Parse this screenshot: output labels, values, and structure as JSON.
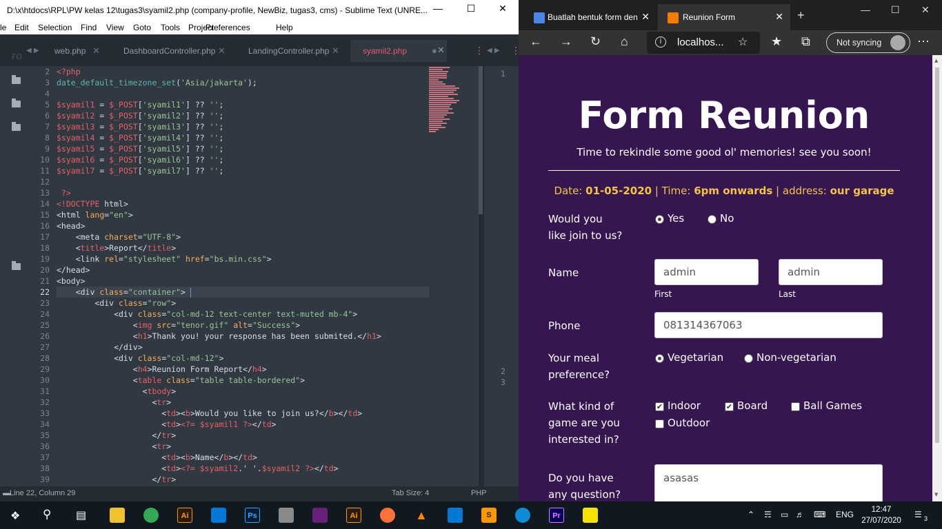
{
  "sublime": {
    "title": "D:\\x\\htdocs\\RPL\\PW kelas 12\\tugas3\\syamil2.php (company-profile, NewBiz, tugas3, cms) - Sublime Text (UNRE...",
    "menu": [
      "le",
      "Edit",
      "Selection",
      "Find",
      "View",
      "Goto",
      "Tools",
      "Project",
      "Preferences",
      "Help"
    ],
    "tabs": [
      "web.php",
      "DashboardController.php",
      "LandingController.php",
      "syamil2.php"
    ],
    "active_tab": "syamil2.php",
    "gutter": [
      "2",
      "3",
      "4",
      "5",
      "6",
      "7",
      "8",
      "9",
      "10",
      "11",
      "12",
      "13",
      "14",
      "15",
      "16",
      "17",
      "18",
      "19",
      "20",
      "21",
      "22",
      "23",
      "24",
      "25",
      "26",
      "27",
      "28",
      "29",
      "30",
      "31",
      "32",
      "33",
      "34",
      "35",
      "36",
      "37",
      "38",
      "39"
    ],
    "second_pane_lines": [
      "1",
      "2",
      "3"
    ],
    "status_position": "Line 22, Column 29",
    "status_tab": "Tab Size: 4",
    "status_syntax": "PHP",
    "sidebar_label": "FO"
  },
  "code_lines": [
    [
      [
        "<?php",
        "t-tag"
      ]
    ],
    [
      [
        "date_default_timezone_set",
        "t-fn"
      ],
      [
        "(",
        ""
      ],
      [
        "'Asia/jakarta'",
        "t-str"
      ],
      [
        ");",
        ""
      ]
    ],
    [
      [
        "",
        ""
      ]
    ],
    [
      [
        "$syamil1",
        "t-var"
      ],
      [
        " = ",
        ""
      ],
      [
        "$_POST",
        "t-var"
      ],
      [
        "[",
        ""
      ],
      [
        "'syamil1'",
        "t-str"
      ],
      [
        "] ?? ",
        ""
      ],
      [
        "''",
        "t-str"
      ],
      [
        ";",
        ""
      ]
    ],
    [
      [
        "$syamil2",
        "t-var"
      ],
      [
        " = ",
        ""
      ],
      [
        "$_POST",
        "t-var"
      ],
      [
        "[",
        ""
      ],
      [
        "'syamil2'",
        "t-str"
      ],
      [
        "] ?? ",
        ""
      ],
      [
        "''",
        "t-str"
      ],
      [
        ";",
        ""
      ]
    ],
    [
      [
        "$syamil3",
        "t-var"
      ],
      [
        " = ",
        ""
      ],
      [
        "$_POST",
        "t-var"
      ],
      [
        "[",
        ""
      ],
      [
        "'syamil3'",
        "t-str"
      ],
      [
        "] ?? ",
        ""
      ],
      [
        "''",
        "t-str"
      ],
      [
        ";",
        ""
      ]
    ],
    [
      [
        "$syamil4",
        "t-var"
      ],
      [
        " = ",
        ""
      ],
      [
        "$_POST",
        "t-var"
      ],
      [
        "[",
        ""
      ],
      [
        "'syamil4'",
        "t-str"
      ],
      [
        "] ?? ",
        ""
      ],
      [
        "''",
        "t-str"
      ],
      [
        ";",
        ""
      ]
    ],
    [
      [
        "$syamil5",
        "t-var"
      ],
      [
        " = ",
        ""
      ],
      [
        "$_POST",
        "t-var"
      ],
      [
        "[",
        ""
      ],
      [
        "'syamil5'",
        "t-str"
      ],
      [
        "] ?? ",
        ""
      ],
      [
        "''",
        "t-str"
      ],
      [
        ";",
        ""
      ]
    ],
    [
      [
        "$syamil6",
        "t-var"
      ],
      [
        " = ",
        ""
      ],
      [
        "$_POST",
        "t-var"
      ],
      [
        "[",
        ""
      ],
      [
        "'syamil6'",
        "t-str"
      ],
      [
        "] ?? ",
        ""
      ],
      [
        "''",
        "t-str"
      ],
      [
        ";",
        ""
      ]
    ],
    [
      [
        "$syamil7",
        "t-var"
      ],
      [
        " = ",
        ""
      ],
      [
        "$_POST",
        "t-var"
      ],
      [
        "[",
        ""
      ],
      [
        "'syamil7'",
        "t-str"
      ],
      [
        "] ?? ",
        ""
      ],
      [
        "''",
        "t-str"
      ],
      [
        ";",
        ""
      ]
    ],
    [
      [
        "",
        ""
      ]
    ],
    [
      [
        " ?>",
        "t-tag"
      ]
    ],
    [
      [
        "<!DOCTYPE ",
        "t-tag"
      ],
      [
        "html>",
        ""
      ]
    ],
    [
      [
        "<html ",
        ""
      ],
      [
        "lang",
        "t-at"
      ],
      [
        "=",
        ""
      ],
      [
        "\"en\"",
        "t-str"
      ],
      [
        ">",
        ""
      ]
    ],
    [
      [
        "<head>",
        ""
      ]
    ],
    [
      [
        "    <meta ",
        ""
      ],
      [
        "charset",
        "t-at"
      ],
      [
        "=",
        ""
      ],
      [
        "\"UTF-8\"",
        "t-str"
      ],
      [
        ">",
        ""
      ]
    ],
    [
      [
        "    <",
        ""
      ],
      [
        "title",
        "t-tag"
      ],
      [
        ">Report</",
        ""
      ],
      [
        "title",
        "t-tag"
      ],
      [
        ">",
        ""
      ]
    ],
    [
      [
        "    <link ",
        ""
      ],
      [
        "rel",
        "t-at"
      ],
      [
        "=",
        ""
      ],
      [
        "\"stylesheet\"",
        "t-str"
      ],
      [
        " ",
        ""
      ],
      [
        "href",
        "t-at"
      ],
      [
        "=",
        ""
      ],
      [
        "\"bs.min.css\"",
        "t-str"
      ],
      [
        ">",
        ""
      ]
    ],
    [
      [
        "</head>",
        ""
      ]
    ],
    [
      [
        "<body>",
        ""
      ]
    ],
    [
      [
        "    <div ",
        ""
      ],
      [
        "class",
        "t-at"
      ],
      [
        "=",
        ""
      ],
      [
        "\"container\"",
        "t-str"
      ],
      [
        "> ",
        ""
      ]
    ],
    [
      [
        "        <div ",
        ""
      ],
      [
        "class",
        "t-at"
      ],
      [
        "=",
        ""
      ],
      [
        "\"row\"",
        "t-str"
      ],
      [
        ">",
        ""
      ]
    ],
    [
      [
        "            <div ",
        ""
      ],
      [
        "class",
        "t-at"
      ],
      [
        "=",
        ""
      ],
      [
        "\"col-md-12 text-center text-muted mb-4\"",
        "t-str"
      ],
      [
        ">",
        ""
      ]
    ],
    [
      [
        "                <",
        ""
      ],
      [
        "img",
        "t-tag"
      ],
      [
        " ",
        ""
      ],
      [
        "src",
        "t-at"
      ],
      [
        "=",
        ""
      ],
      [
        "\"tenor.gif\"",
        "t-str"
      ],
      [
        " ",
        ""
      ],
      [
        "alt",
        "t-at"
      ],
      [
        "=",
        ""
      ],
      [
        "\"Success\"",
        "t-str"
      ],
      [
        ">",
        ""
      ]
    ],
    [
      [
        "                <",
        ""
      ],
      [
        "h1",
        "t-tag"
      ],
      [
        ">Thank you! your response has been submited.</",
        ""
      ],
      [
        "h1",
        "t-tag"
      ],
      [
        ">",
        ""
      ]
    ],
    [
      [
        "            </div>",
        ""
      ]
    ],
    [
      [
        "            <div ",
        ""
      ],
      [
        "class",
        "t-at"
      ],
      [
        "=",
        ""
      ],
      [
        "\"col-md-12\"",
        "t-str"
      ],
      [
        ">",
        ""
      ]
    ],
    [
      [
        "                <",
        ""
      ],
      [
        "h4",
        "t-tag"
      ],
      [
        ">Reunion Form Report</",
        ""
      ],
      [
        "h4",
        "t-tag"
      ],
      [
        ">",
        ""
      ]
    ],
    [
      [
        "                <",
        ""
      ],
      [
        "table",
        "t-tag"
      ],
      [
        " ",
        ""
      ],
      [
        "class",
        "t-at"
      ],
      [
        "=",
        ""
      ],
      [
        "\"table table-bordered\"",
        "t-str"
      ],
      [
        ">",
        ""
      ]
    ],
    [
      [
        "                  <",
        ""
      ],
      [
        "tbody",
        "t-tag"
      ],
      [
        ">",
        ""
      ]
    ],
    [
      [
        "                    <",
        ""
      ],
      [
        "tr",
        "t-tag"
      ],
      [
        ">",
        ""
      ]
    ],
    [
      [
        "                      <",
        ""
      ],
      [
        "td",
        "t-tag"
      ],
      [
        "><",
        ""
      ],
      [
        "b",
        "t-tag"
      ],
      [
        ">Would you like to join us?</",
        ""
      ],
      [
        "b",
        "t-tag"
      ],
      [
        "></",
        ""
      ],
      [
        "td",
        "t-tag"
      ],
      [
        ">",
        ""
      ]
    ],
    [
      [
        "                      <",
        ""
      ],
      [
        "td",
        "t-tag"
      ],
      [
        ">",
        ""
      ],
      [
        "<?= ",
        "t-tag"
      ],
      [
        "$syamil1",
        "t-var"
      ],
      [
        " ?>",
        "t-tag"
      ],
      [
        "</",
        ""
      ],
      [
        "td",
        "t-tag"
      ],
      [
        ">",
        ""
      ]
    ],
    [
      [
        "                    </",
        ""
      ],
      [
        "tr",
        "t-tag"
      ],
      [
        ">",
        ""
      ]
    ],
    [
      [
        "                    <",
        ""
      ],
      [
        "tr",
        "t-tag"
      ],
      [
        ">",
        ""
      ]
    ],
    [
      [
        "                      <",
        ""
      ],
      [
        "td",
        "t-tag"
      ],
      [
        "><",
        ""
      ],
      [
        "b",
        "t-tag"
      ],
      [
        ">Name</",
        ""
      ],
      [
        "b",
        "t-tag"
      ],
      [
        "></",
        ""
      ],
      [
        "td",
        "t-tag"
      ],
      [
        ">",
        ""
      ]
    ],
    [
      [
        "                      <",
        ""
      ],
      [
        "td",
        "t-tag"
      ],
      [
        ">",
        ""
      ],
      [
        "<?= ",
        "t-tag"
      ],
      [
        "$syamil2",
        "t-var"
      ],
      [
        ".' '.",
        ""
      ],
      [
        "$syamil2",
        "t-var"
      ],
      [
        " ?>",
        "t-tag"
      ],
      [
        "</",
        ""
      ],
      [
        "td",
        "t-tag"
      ],
      [
        ">",
        ""
      ]
    ],
    [
      [
        "                    </",
        ""
      ],
      [
        "tr",
        "t-tag"
      ],
      [
        ">",
        ""
      ]
    ]
  ],
  "edge": {
    "tabs": [
      "Buatlah bentuk form den",
      "Reunion Form"
    ],
    "address": "localhos...",
    "sync_label": "Not syncing"
  },
  "form": {
    "title": "Form Reunion",
    "subtitle": "Time to rekindle some good ol' memories! see you soon!",
    "info_date_label": "Date: ",
    "info_date": "01-05-2020",
    "info_sep1": " | Time: ",
    "info_time": "6pm onwards",
    "info_sep2": " | address: ",
    "info_address": "our garage",
    "join_label_1": "Would you",
    "join_label_2": "like join to us?",
    "join_yes": "Yes",
    "join_no": "No",
    "name_label": "Name",
    "first_value": "admin",
    "last_value": "admin",
    "first_label": "First",
    "last_label": "Last",
    "phone_label": "Phone",
    "phone_value": "081314367063",
    "meal_label_1": "Your meal",
    "meal_label_2": "preference?",
    "meal_veg": "Vegetarian",
    "meal_nonveg": "Non-vegetarian",
    "game_label_1": "What kind of",
    "game_label_2": "game are you",
    "game_label_3": "interested in?",
    "game_indoor": "Indoor",
    "game_board": "Board",
    "game_ball": "Ball Games",
    "game_outdoor": "Outdoor",
    "question_label_1": "Do you have",
    "question_label_2": "any question?",
    "question_value": "asasas"
  },
  "taskbar": {
    "lang": "ENG",
    "time": "12:47",
    "date": "27/07/2020",
    "notifications": "3"
  }
}
